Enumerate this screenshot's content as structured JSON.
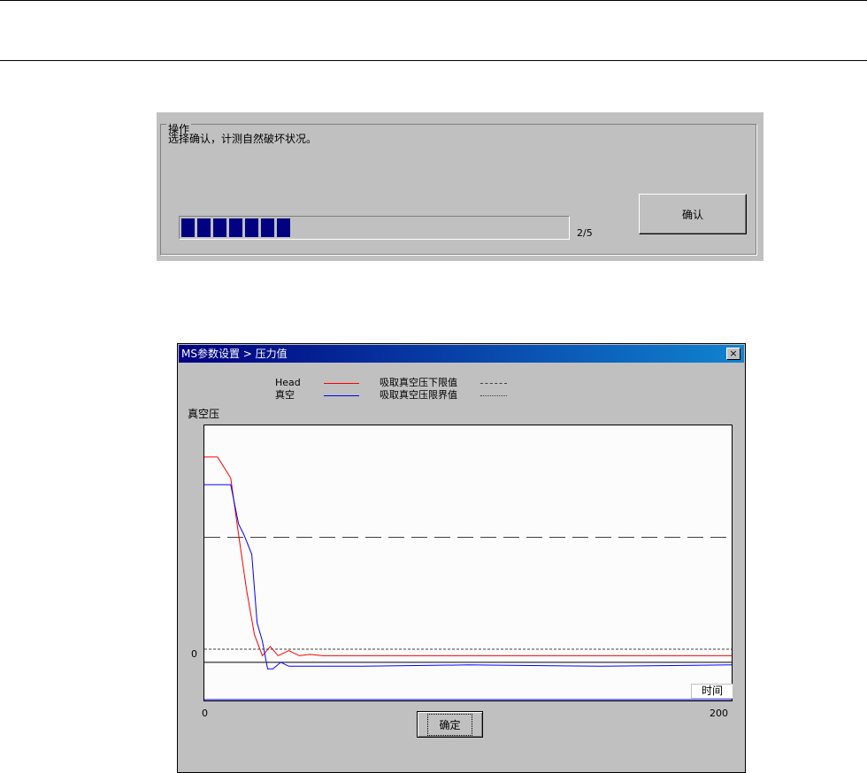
{
  "operation": {
    "group_title": "操作",
    "instruction": "选择确认，计测自然破坏状况。",
    "confirm_button": "确认",
    "progress": {
      "count_text": "2/5",
      "blocks_filled": 7
    }
  },
  "dialog": {
    "title": "MS参数设置 > 压力值",
    "close_label": "×",
    "confirm_button": "确定",
    "legend": {
      "head_label": "Head",
      "vacuum_label": "真空",
      "lower_limit_label": "吸取真空压下限值",
      "limit_label": "吸取真空压限界值"
    }
  },
  "chart_data": {
    "type": "line",
    "ylabel": "真空压",
    "xlabel": "时间",
    "x_ticks": [
      "0",
      "200"
    ],
    "y_ticks": [
      "0"
    ],
    "xlim": [
      0,
      200
    ],
    "colors": {
      "head": "#ff0000",
      "vacuum": "#0000ff",
      "lower_limit": "#404040",
      "limit": "#404040"
    },
    "series": [
      {
        "name": "Head",
        "x": [
          0,
          5,
          10,
          13,
          16,
          19,
          22,
          25,
          28,
          32,
          36,
          40,
          45,
          60,
          100,
          150,
          200
        ],
        "y": [
          1.56,
          1.56,
          1.4,
          0.97,
          0.55,
          0.21,
          0.05,
          0.12,
          0.05,
          0.09,
          0.05,
          0.06,
          0.05,
          0.05,
          0.05,
          0.05,
          0.05
        ]
      },
      {
        "name": "真空",
        "x": [
          0,
          10,
          13,
          15,
          18,
          20,
          22,
          24,
          26,
          29,
          32,
          35,
          40,
          60,
          100,
          150,
          200
        ],
        "y": [
          1.35,
          1.35,
          1.05,
          0.97,
          0.82,
          0.3,
          0.16,
          -0.05,
          -0.05,
          0.0,
          -0.03,
          -0.03,
          -0.03,
          -0.03,
          -0.02,
          -0.03,
          -0.02
        ]
      },
      {
        "name": "吸取真空压下限值",
        "x": [
          0,
          200
        ],
        "y": [
          0.95,
          0.95
        ],
        "style": "dashed"
      },
      {
        "name": "吸取真空压限界值",
        "x": [
          0,
          200
        ],
        "y": [
          0.1,
          0.1
        ],
        "style": "dotted"
      }
    ]
  }
}
